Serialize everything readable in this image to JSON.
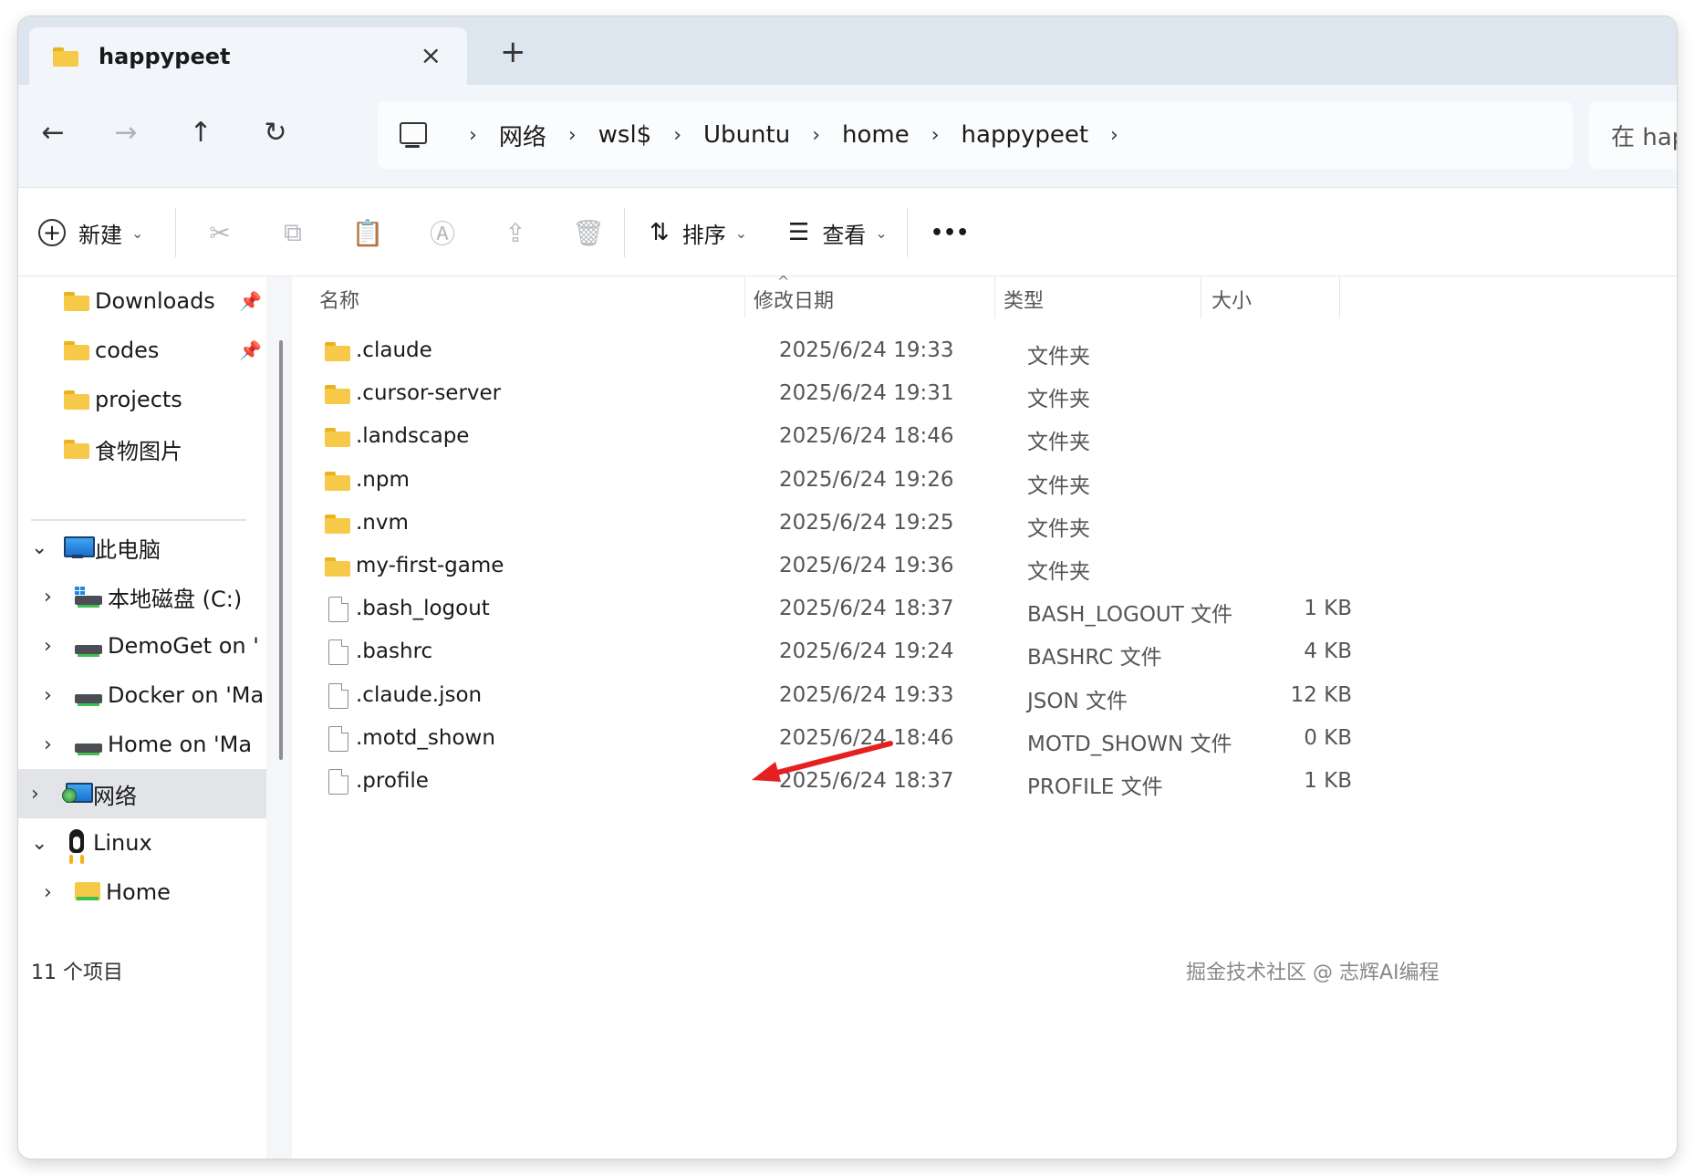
{
  "tab": {
    "title": "happypeet",
    "close_glyph": "×",
    "new_tab_glyph": "+"
  },
  "nav": {
    "back_glyph": "←",
    "forward_glyph": "→",
    "up_glyph": "↑",
    "refresh_glyph": "↻",
    "breadcrumbs": [
      "网络",
      "wsl$",
      "Ubuntu",
      "home",
      "happypeet"
    ],
    "separator": "›",
    "search_text": "在 happ"
  },
  "toolbar": {
    "new_label": "新建",
    "sort_label": "排序",
    "view_label": "查看",
    "more_glyph": "•••",
    "icons": [
      "cut-icon",
      "copy-icon",
      "paste-icon",
      "rename-icon",
      "share-icon",
      "delete-icon"
    ]
  },
  "sidebar": {
    "quick_access": [
      {
        "label": "Downloads",
        "pinned": true
      },
      {
        "label": "codes",
        "pinned": true
      },
      {
        "label": "projects",
        "pinned": false
      },
      {
        "label": "食物图片",
        "pinned": false
      }
    ],
    "this_pc": "此电脑",
    "drives": [
      "本地磁盘 (C:)",
      "DemoGet on '",
      "Docker on 'Ma",
      "Home on 'Ma"
    ],
    "network": "网络",
    "linux": "Linux",
    "linux_home": "Home"
  },
  "columns": {
    "name": "名称",
    "date": "修改日期",
    "type": "类型",
    "size": "大小"
  },
  "files": [
    {
      "name": ".claude",
      "date": "2025/6/24 19:33",
      "type": "文件夹",
      "size": "",
      "kind": "folder"
    },
    {
      "name": ".cursor-server",
      "date": "2025/6/24 19:31",
      "type": "文件夹",
      "size": "",
      "kind": "folder"
    },
    {
      "name": ".landscape",
      "date": "2025/6/24 18:46",
      "type": "文件夹",
      "size": "",
      "kind": "folder"
    },
    {
      "name": ".npm",
      "date": "2025/6/24 19:26",
      "type": "文件夹",
      "size": "",
      "kind": "folder"
    },
    {
      "name": ".nvm",
      "date": "2025/6/24 19:25",
      "type": "文件夹",
      "size": "",
      "kind": "folder"
    },
    {
      "name": "my-first-game",
      "date": "2025/6/24 19:36",
      "type": "文件夹",
      "size": "",
      "kind": "folder"
    },
    {
      "name": ".bash_logout",
      "date": "2025/6/24 18:37",
      "type": "BASH_LOGOUT 文件",
      "size": "1 KB",
      "kind": "file"
    },
    {
      "name": ".bashrc",
      "date": "2025/6/24 19:24",
      "type": "BASHRC 文件",
      "size": "4 KB",
      "kind": "file"
    },
    {
      "name": ".claude.json",
      "date": "2025/6/24 19:33",
      "type": "JSON 文件",
      "size": "12 KB",
      "kind": "file"
    },
    {
      "name": ".motd_shown",
      "date": "2025/6/24 18:46",
      "type": "MOTD_SHOWN 文件",
      "size": "0 KB",
      "kind": "file"
    },
    {
      "name": ".profile",
      "date": "2025/6/24 18:37",
      "type": "PROFILE 文件",
      "size": "1 KB",
      "kind": "file"
    }
  ],
  "status": {
    "item_count": "11 个项目"
  },
  "watermark": "掘金技术社区 @ 志辉AI编程",
  "colors": {
    "accent": "#1b6fd1",
    "annotation_arrow": "#e62020",
    "folder": "#f7c948"
  }
}
